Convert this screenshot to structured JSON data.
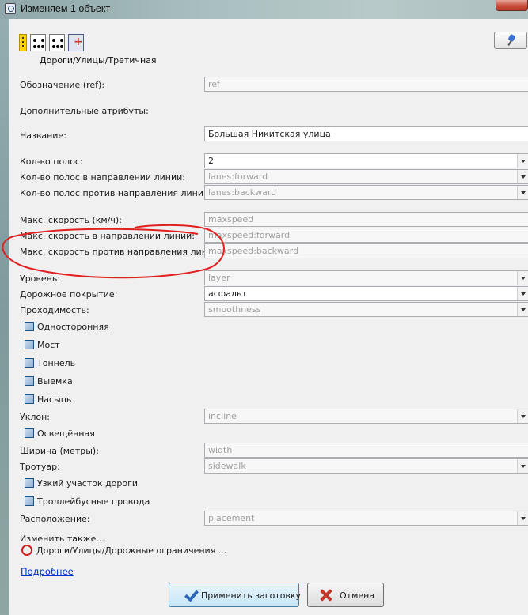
{
  "window": {
    "title": "Изменяем 1 объект"
  },
  "preset": {
    "icons": [
      "road-line-icon",
      "node-points-icon",
      "node-points-icon",
      "add-preset-icon"
    ],
    "path": "Дороги/Улицы/Третичная"
  },
  "fields": {
    "ref": {
      "label": "Обозначение (ref):",
      "value": "ref"
    },
    "extra_attrs": {
      "label": "Дополнительные атрибуты:"
    },
    "name": {
      "label": "Название:",
      "value": "Большая Никитская улица"
    },
    "lanes": {
      "label": "Кол-во полос:",
      "value": "2"
    },
    "lanes_forward": {
      "label": "Кол-во полос в направлении линии:",
      "value": "lanes:forward"
    },
    "lanes_backward": {
      "label": "Кол-во полос против направления линии:",
      "value": "lanes:backward"
    },
    "maxspeed": {
      "label": "Макс. скорость (км/ч):",
      "value": "maxspeed"
    },
    "maxspeed_forward": {
      "label": "Макс. скорость в направлении линии:",
      "value": "maxspeed:forward"
    },
    "maxspeed_backward": {
      "label": "Макс. скорость против направления линии:",
      "value": "maxspeed:backward"
    },
    "layer": {
      "label": "Уровень:",
      "value": "layer"
    },
    "surface": {
      "label": "Дорожное покрытие:",
      "value": "асфальт"
    },
    "smoothness": {
      "label": "Проходимость:",
      "value": "smoothness"
    },
    "incline": {
      "label": "Уклон:",
      "value": "incline"
    },
    "width": {
      "label": "Ширина (метры):",
      "value": "width"
    },
    "sidewalk": {
      "label": "Тротуар:",
      "value": "sidewalk"
    },
    "placement": {
      "label": "Расположение:",
      "value": "placement"
    }
  },
  "checkboxes": {
    "oneway": "Односторонняя",
    "bridge": "Мост",
    "tunnel": "Тоннель",
    "cutting": "Выемка",
    "embankment": "Насыпь",
    "lit": "Освещённая",
    "narrow": "Узкий участок дороги",
    "trolley_wire": "Троллейбусные провода"
  },
  "also_change": {
    "title": "Изменить также...",
    "item": "Дороги/Улицы/Дорожные ограничения ..."
  },
  "more_link": "Подробнее",
  "buttons": {
    "apply": "Применить заготовку",
    "cancel": "Отмена"
  },
  "colors": {
    "annotation": "#e02020",
    "link": "#0033cc",
    "apply_border": "#3c7fb1"
  }
}
